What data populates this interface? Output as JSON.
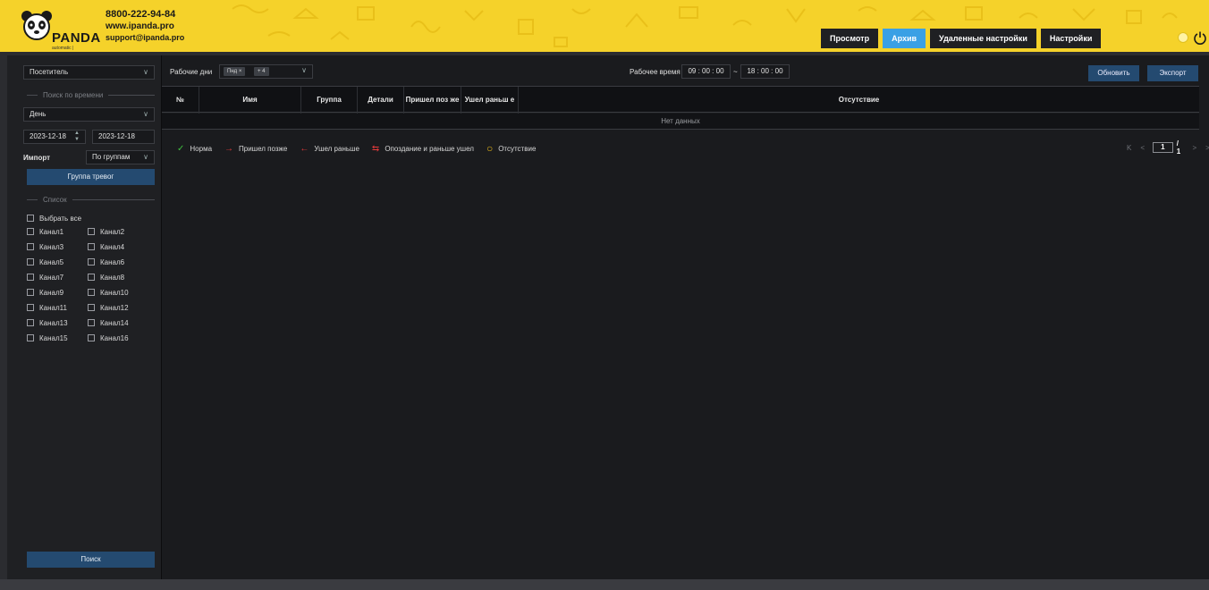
{
  "header": {
    "brand": "PANDA",
    "brand_sub": "automatic | ",
    "phone": "8800-222-94-84",
    "website": "www.ipanda.pro",
    "email": "support@ipanda.pro",
    "nav": [
      {
        "label": "Просмотр",
        "active": false
      },
      {
        "label": "Архив",
        "active": true
      },
      {
        "label": "Удаленные настройки",
        "active": false
      },
      {
        "label": "Настройки",
        "active": false
      }
    ],
    "accent_color": "#3aa0e5",
    "header_color": "#f5d22a"
  },
  "sidebar": {
    "mode_select": "Посетитель",
    "time_search_label": "Поиск по времени",
    "period_select": "День",
    "date_from": "2023-12-18",
    "date_to": "2023-12-18",
    "import_label": "Импорт",
    "import_select": "По группам",
    "alarm_group_button": "Группа тревог",
    "list_label": "Список",
    "select_all": "Выбрать все",
    "channels": [
      "Канал1",
      "Канал2",
      "Канал3",
      "Канал4",
      "Канал5",
      "Канал6",
      "Канал7",
      "Канал8",
      "Канал9",
      "Канал10",
      "Канал11",
      "Канал12",
      "Канал13",
      "Канал14",
      "Канал15",
      "Канал16"
    ],
    "search_button": "Поиск"
  },
  "toolbar": {
    "workdays_label": "Рабочие дни",
    "day_tag": "Пнд",
    "more_tag": "+ 4",
    "worktime_label": "Рабочее время",
    "time_from": "09 : 00 : 00",
    "time_sep": "~",
    "time_to": "18 : 00 : 00",
    "refresh_button": "Обновить",
    "export_button": "Экспорт"
  },
  "table": {
    "columns": [
      "№",
      "Имя",
      "Группа",
      "Детали",
      "Пришел поз же",
      "Ушел раньш е",
      "Отсутствие"
    ],
    "empty_text": "Нет данных"
  },
  "legend": [
    {
      "label": "Норма",
      "icon": "check-icon",
      "color": "#3fbf3f"
    },
    {
      "label": "Пришел позже",
      "icon": "arrow-right-icon",
      "color": "#e23a3a"
    },
    {
      "label": "Ушел раньше",
      "icon": "arrow-left-icon",
      "color": "#e23a3a"
    },
    {
      "label": "Опоздание и раньше ушел",
      "icon": "swap-arrows-icon",
      "color": "#e23a3a"
    },
    {
      "label": "Отсутствие",
      "icon": "circle-icon",
      "color": "#e8b81a"
    }
  ],
  "pager": {
    "first": "K",
    "prev": "<",
    "current": "1",
    "total": "/ 1",
    "next": ">",
    "last": ">|"
  }
}
